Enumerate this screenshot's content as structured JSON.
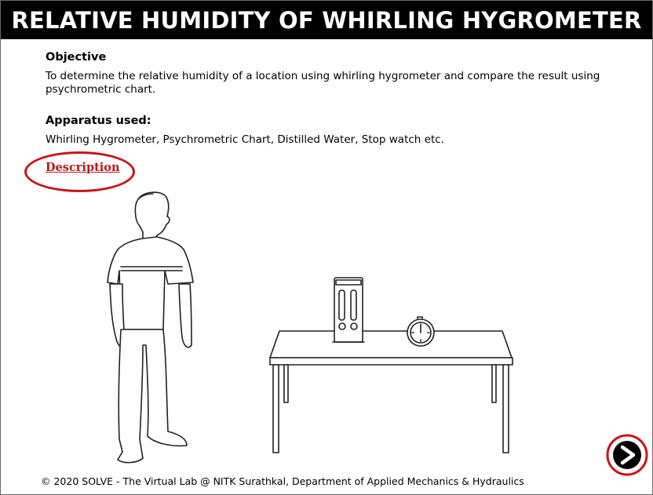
{
  "header": {
    "title": "RELATIVE HUMIDITY OF WHIRLING HYGROMETER"
  },
  "objective": {
    "heading": "Objective",
    "text": "To determine the relative humidity of a location using whirling hygrometer and compare the result using psychrometric chart."
  },
  "apparatus": {
    "heading": "Apparatus used:",
    "text": "Whirling Hygrometer, Psychrometric Chart, Distilled Water, Stop watch etc."
  },
  "description_link": "Description",
  "footer": "© 2020 SOLVE - The Virtual Lab @ NITK Surathkal, Department of Applied Mechanics & Hydraulics",
  "colors": {
    "accent_red": "#c8141c",
    "title_bg": "#000000",
    "title_fg": "#ffffff"
  },
  "icons": {
    "next": "chevron-right-icon"
  }
}
